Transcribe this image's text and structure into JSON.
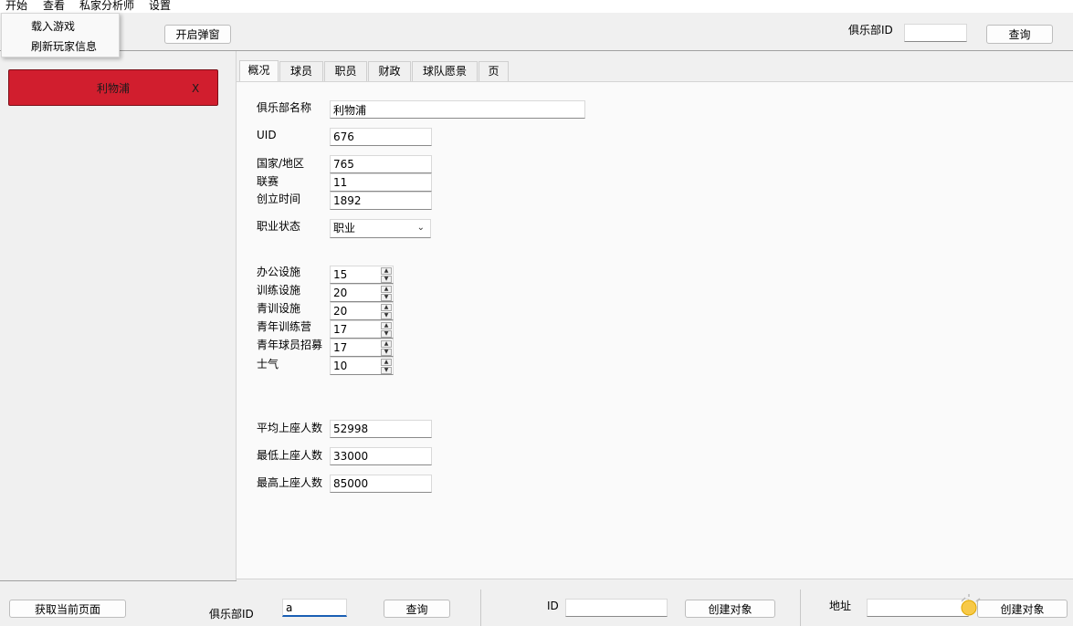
{
  "menubar": {
    "items": [
      "开始",
      "查看",
      "私家分析师",
      "设置"
    ]
  },
  "dropdown": {
    "items": [
      "载入游戏",
      "刷新玩家信息"
    ]
  },
  "toolbar": {
    "open_popup_label": "开启弹窗",
    "club_id_label": "俱乐部ID",
    "club_id_value": "",
    "query_label": "查询"
  },
  "sidebar": {
    "club_card": {
      "name": "利物浦",
      "close": "X",
      "color": "#d11e2e"
    }
  },
  "tabs": [
    "概况",
    "球员",
    "职员",
    "财政",
    "球队愿景",
    "页"
  ],
  "overview": {
    "club_name_label": "俱乐部名称",
    "club_name_value": "利物浦",
    "uid_label": "UID",
    "uid_value": "676",
    "nation_label": "国家/地区",
    "nation_value": "765",
    "league_label": "联赛",
    "league_value": "11",
    "founded_label": "创立时间",
    "founded_value": "1892",
    "status_label": "职业状态",
    "status_value": "职业",
    "facilities": [
      {
        "label": "办公设施",
        "value": "15"
      },
      {
        "label": "训练设施",
        "value": "20"
      },
      {
        "label": "青训设施",
        "value": "20"
      },
      {
        "label": "青年训练营",
        "value": "17"
      },
      {
        "label": "青年球员招募",
        "value": "17"
      },
      {
        "label": "士气",
        "value": "10"
      }
    ],
    "avg_att_label": "平均上座人数",
    "avg_att_value": "52998",
    "min_att_label": "最低上座人数",
    "min_att_value": "33000",
    "max_att_label": "最高上座人数",
    "max_att_value": "85000"
  },
  "bottom": {
    "get_page_label": "获取当前页面",
    "club_id_label": "俱乐部ID",
    "club_id_value": "a",
    "query_label": "查询",
    "id_label": "ID",
    "id_value": "",
    "create_object_label": "创建对象",
    "address_label": "地址",
    "address_value": "",
    "create_object2_label": "创建对象"
  }
}
